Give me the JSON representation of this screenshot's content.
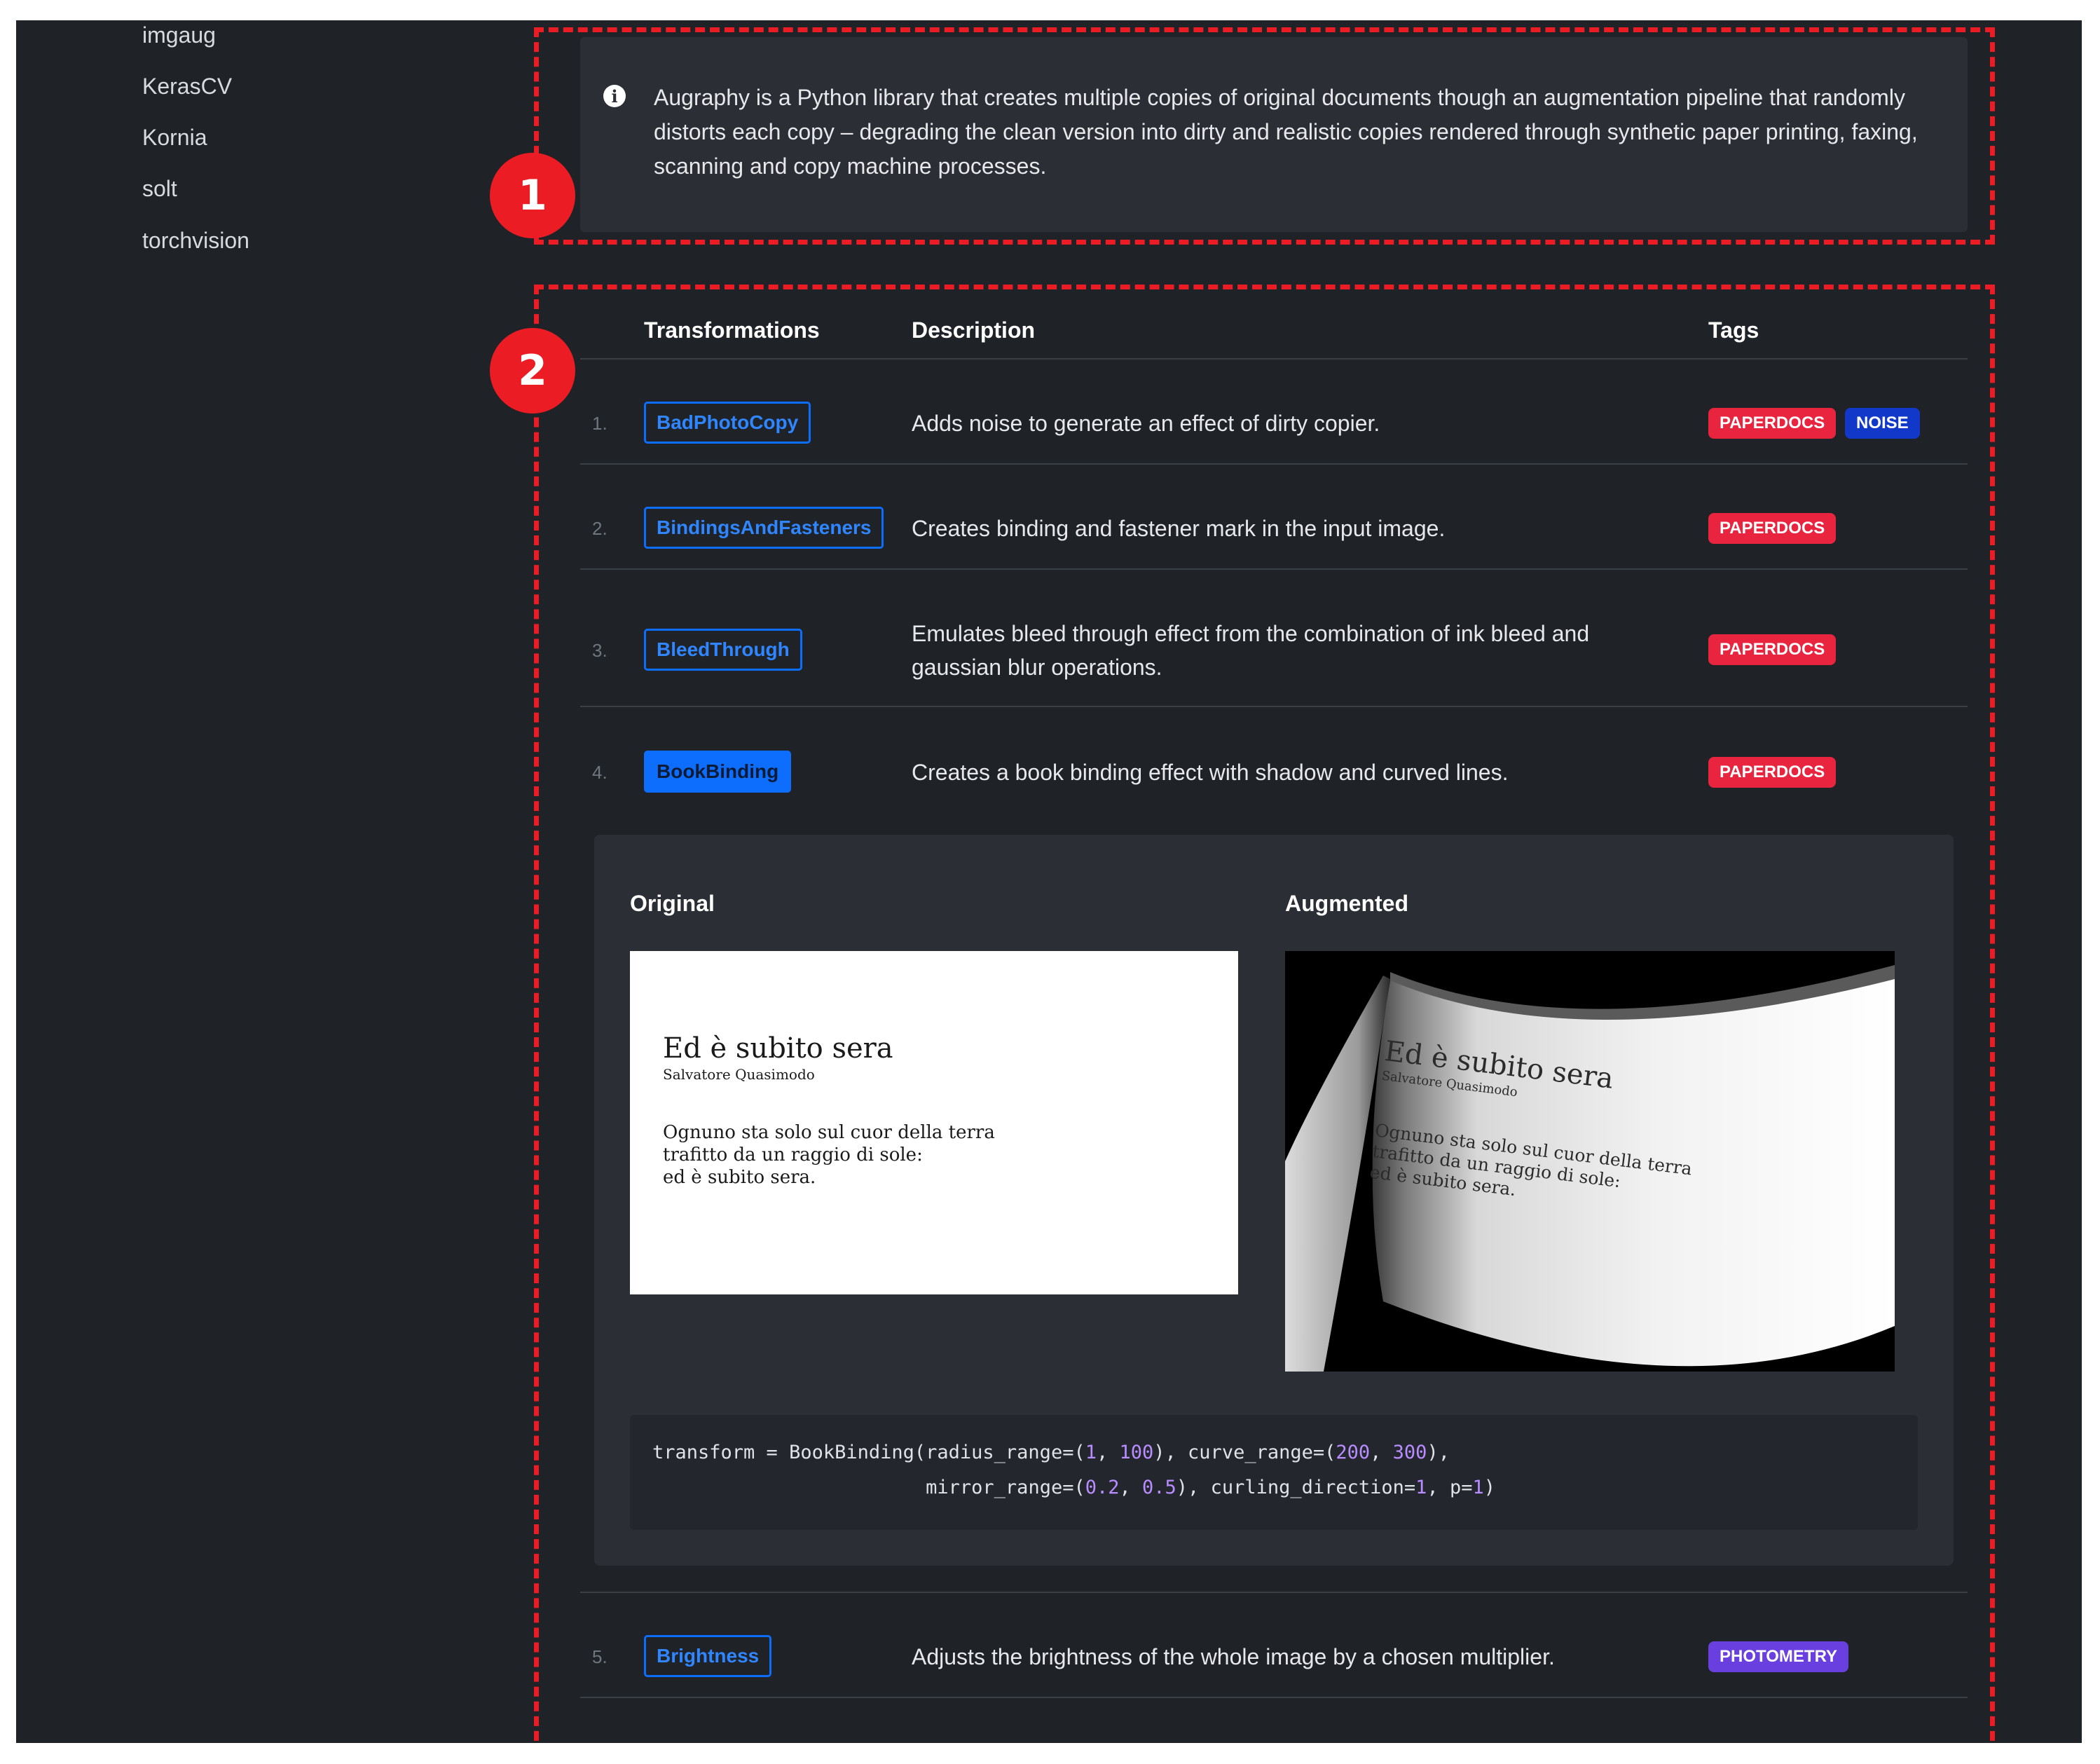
{
  "sidebar": {
    "items": [
      {
        "label": "imgaug"
      },
      {
        "label": "KerasCV"
      },
      {
        "label": "Kornia"
      },
      {
        "label": "solt"
      },
      {
        "label": "torchvision"
      }
    ]
  },
  "annotations": {
    "badge_1": "1",
    "badge_2": "2",
    "color": "#ec1c24"
  },
  "info_callout": {
    "icon": "info-icon",
    "text": "Augraphy is a Python library that creates multiple copies of original documents though an augmentation pipeline that randomly distorts each copy – degrading the clean version into dirty and realistic copies rendered through synthetic paper printing, faxing, scanning and copy machine processes."
  },
  "table": {
    "headers": {
      "transformations": "Transformations",
      "description": "Description",
      "tags": "Tags"
    },
    "rows": [
      {
        "num": "1.",
        "name": "BadPhotoCopy",
        "description": "Adds noise to generate an effect of dirty copier.",
        "tags": [
          "PAPERDOCS",
          "NOISE"
        ]
      },
      {
        "num": "2.",
        "name": "BindingsAndFasteners",
        "description": "Creates binding and fastener mark in the input image.",
        "tags": [
          "PAPERDOCS"
        ]
      },
      {
        "num": "3.",
        "name": "BleedThrough",
        "description_lines": [
          "Emulates bleed through effect from the combination of ink bleed and",
          "gaussian blur operations."
        ],
        "tags": [
          "PAPERDOCS"
        ]
      },
      {
        "num": "4.",
        "name": "BookBinding",
        "description": "Creates a book binding effect with shadow and curved lines.",
        "tags": [
          "PAPERDOCS"
        ],
        "expanded": true
      },
      {
        "num": "5.",
        "name": "Brightness",
        "description": "Adjusts the brightness of the whole image by a chosen multiplier.",
        "tags": [
          "PHOTOMETRY"
        ]
      }
    ]
  },
  "tag_colors": {
    "PAPERDOCS": "#e8243f",
    "NOISE": "#1238c9",
    "PHOTOMETRY": "#6a3fe0"
  },
  "accent": "#0d6efd",
  "preview": {
    "original_label": "Original",
    "augmented_label": "Augmented",
    "doc": {
      "title": "Ed è subito sera",
      "author": "Salvatore Quasimodo",
      "lines": [
        "Ognuno sta solo sul cuor della terra",
        "trafitto da un raggio di sole:",
        "ed è subito sera."
      ]
    },
    "code": {
      "line1_prefix": "transform = BookBinding(radius_range=(",
      "n1": "1",
      "sep1": ", ",
      "n2": "100",
      "mid1": "), curve_range=(",
      "n3": "200",
      "sep2": ", ",
      "n4": "300",
      "end1": "),",
      "line2_indent": "                        ",
      "line2_prefix": "mirror_range=(",
      "n5": "0.2",
      "sep3": ", ",
      "n6": "0.5",
      "mid2": "), curling_direction=",
      "n7": "1",
      "mid3": ", p=",
      "n8": "1",
      "end2": ")"
    }
  }
}
